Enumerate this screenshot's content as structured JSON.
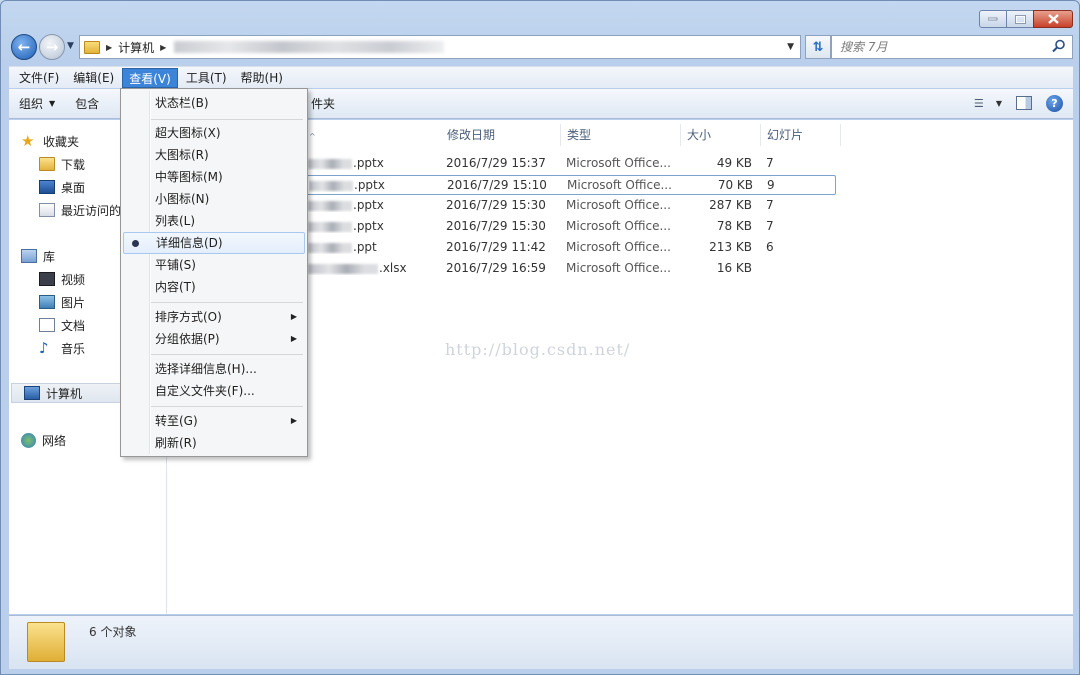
{
  "window": {
    "breadcrumb_root": "计算机",
    "search_placeholder": "搜索 7月"
  },
  "menubar": {
    "items": [
      "文件(F)",
      "编辑(E)",
      "查看(V)",
      "工具(T)",
      "帮助(H)"
    ],
    "active_index": 2
  },
  "toolbar": {
    "organize": "组织",
    "include": "包含",
    "new_folder_tail": "件夹"
  },
  "navigation": {
    "favorites": "收藏夹",
    "downloads": "下载",
    "desktop": "桌面",
    "recent": "最近访问的",
    "libraries": "库",
    "videos": "视频",
    "pictures": "图片",
    "documents": "文档",
    "music": "音乐",
    "computer": "计算机",
    "network": "网络"
  },
  "columns": {
    "date": "修改日期",
    "type": "类型",
    "size": "大小",
    "slides": "幻灯片"
  },
  "files": [
    {
      "name_suffix": ".pptx",
      "date": "2016/7/29 15:37",
      "type": "Microsoft Office...",
      "size": "49 KB",
      "slides": "7"
    },
    {
      "name_suffix": ".pptx",
      "date": "2016/7/29 15:10",
      "type": "Microsoft Office...",
      "size": "70 KB",
      "slides": "9"
    },
    {
      "name_suffix": ".pptx",
      "date": "2016/7/29 15:30",
      "type": "Microsoft Office...",
      "size": "287 KB",
      "slides": "7"
    },
    {
      "name_suffix": ".pptx",
      "date": "2016/7/29 15:30",
      "type": "Microsoft Office...",
      "size": "78 KB",
      "slides": "7"
    },
    {
      "name_suffix": ".ppt",
      "date": "2016/7/29 11:42",
      "type": "Microsoft Office...",
      "size": "213 KB",
      "slides": "6"
    },
    {
      "name_suffix": ".xlsx",
      "date": "2016/7/29 16:59",
      "type": "Microsoft Office...",
      "size": "16 KB",
      "slides": ""
    }
  ],
  "watermark": "http://blog.csdn.net/",
  "status": {
    "count_text": "6 个对象"
  },
  "view_menu": {
    "status_bar": "状态栏(B)",
    "extra_large_icons": "超大图标(X)",
    "large_icons": "大图标(R)",
    "medium_icons": "中等图标(M)",
    "small_icons": "小图标(N)",
    "list": "列表(L)",
    "details": "详细信息(D)",
    "tiles": "平铺(S)",
    "content": "内容(T)",
    "sort_by": "排序方式(O)",
    "group_by": "分组依据(P)",
    "choose_details": "选择详细信息(H)...",
    "customize_folder": "自定义文件夹(F)...",
    "go_to": "转至(G)",
    "refresh": "刷新(R)"
  },
  "colors": {
    "menu_active": "#3c84d8",
    "selection_border": "#7da2ce",
    "close_button": "#c8412a"
  }
}
